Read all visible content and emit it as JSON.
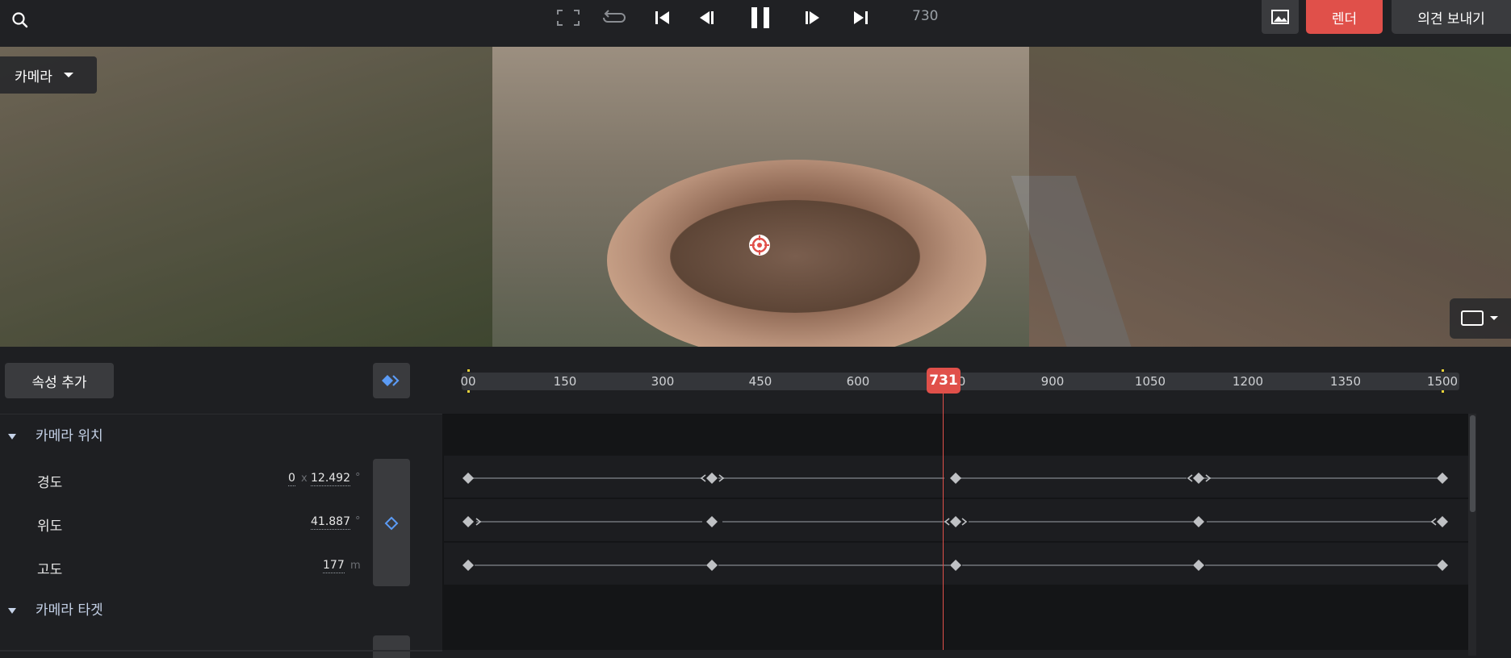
{
  "toolbar": {
    "frame_readout": "730",
    "render_label": "렌더",
    "feedback_label": "의견 보내기",
    "icons": [
      "search-icon",
      "fullscreen-icon",
      "loop-icon",
      "skip-start-icon",
      "step-back-icon",
      "pause-icon",
      "step-forward-icon",
      "skip-end-icon",
      "image-icon"
    ]
  },
  "viewport": {
    "camera_dropdown_label": "카메라",
    "aspect_icon": "aspect-ratio-icon"
  },
  "timeline": {
    "add_property_label": "속성 추가",
    "ruler_ticks": [
      "00",
      "150",
      "300",
      "450",
      "600",
      "750",
      "900",
      "1050",
      "1200",
      "1350",
      "1500"
    ],
    "current_frame": "731",
    "groups": [
      {
        "label": "카메라 위치",
        "properties": [
          {
            "label": "경도",
            "value_a": "0",
            "sep": "x",
            "value": "12.492",
            "unit": "°"
          },
          {
            "label": "위도",
            "value": "41.887",
            "unit": "°"
          },
          {
            "label": "고도",
            "value": "177",
            "unit": "m"
          }
        ]
      },
      {
        "label": "카메라 타겟",
        "properties": [
          {
            "label": "",
            "value": "",
            "unit": ""
          }
        ]
      }
    ],
    "colors": {
      "accent": "#e0504a",
      "keyframe_blue": "#5b9bf5",
      "ruler_marker": "#e8d23a"
    }
  }
}
